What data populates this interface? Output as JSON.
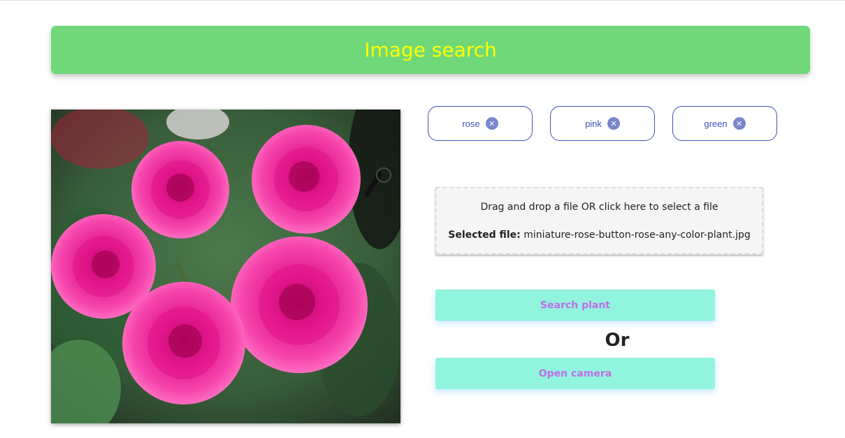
{
  "header": {
    "title": "Image search"
  },
  "image": {
    "subject": "pink roses on green foliage",
    "alt_name": "uploaded-plant-photo"
  },
  "tags": [
    {
      "label": "rose",
      "remove_glyph": "✕"
    },
    {
      "label": "pink",
      "remove_glyph": "✕"
    },
    {
      "label": "green",
      "remove_glyph": "✕"
    }
  ],
  "upload": {
    "prompt": "Drag and drop a file OR click here to select a file",
    "selected_label": "Selected file:",
    "selected_file": "miniature-rose-button-rose-any-color-plant.jpg"
  },
  "actions": {
    "search_label": "Search plant",
    "or_label": "Or",
    "camera_label": "Open camera"
  },
  "colors": {
    "header_bg": "#70d879",
    "header_text": "#ffff00",
    "chip_border": "#3f51b5",
    "button_bg": "#91f4df",
    "button_text": "#c06ee8"
  }
}
